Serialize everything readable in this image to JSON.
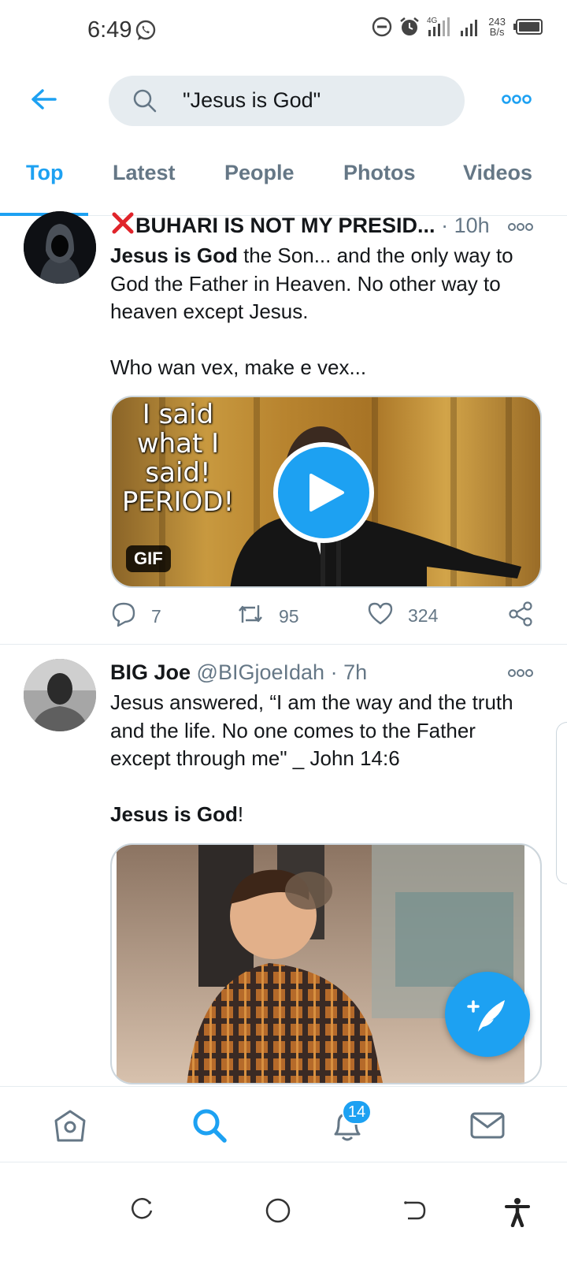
{
  "status_bar": {
    "time": "6:49",
    "network_type": "4G",
    "net_speed_value": "243",
    "net_speed_unit": "B/s",
    "icons": [
      "whatsapp-icon",
      "dnd-icon",
      "alarm-icon",
      "signal-icon",
      "battery-icon"
    ]
  },
  "header": {
    "search_query": "\"Jesus is God\""
  },
  "tabs": [
    {
      "label": "Top",
      "active": true
    },
    {
      "label": "Latest",
      "active": false
    },
    {
      "label": "People",
      "active": false
    },
    {
      "label": "Photos",
      "active": false
    },
    {
      "label": "Videos",
      "active": false
    }
  ],
  "tweets": [
    {
      "display_name": "BUHARI IS NOT MY PRESID...",
      "name_prefix_icon": "red-cross-icon",
      "separator": "·",
      "time": "10h",
      "body_bold_1": "Jesus is God",
      "body_line_1": " the Son... and the only way to God the Father in Heaven. No other way to heaven except Jesus.",
      "body_line_2": "Who wan vex, make e vex...",
      "media": {
        "type": "gif",
        "caption": "I said what I said! PERIOD!",
        "badge": "GIF"
      },
      "actions": {
        "replies": "7",
        "retweets": "95",
        "likes": "324"
      }
    },
    {
      "display_name": "BIG Joe",
      "handle": "@BIGjoeIdah",
      "separator": "·",
      "time": "7h",
      "body_line_1": "Jesus answered, “I am the way and the truth and the life. No one comes to the Father except through me\" _ John 14:6",
      "body_bold_2": "Jesus is God",
      "body_suffix_2": "!"
    }
  ],
  "bottom_nav": {
    "notifications_badge": "14",
    "items": [
      "home-icon",
      "search-icon",
      "notifications-icon",
      "messages-icon"
    ]
  },
  "colors": {
    "accent": "#1da1f2",
    "secondary_text": "#657786",
    "search_bg": "#e6ecf0",
    "red_cross": "#e0242b"
  }
}
